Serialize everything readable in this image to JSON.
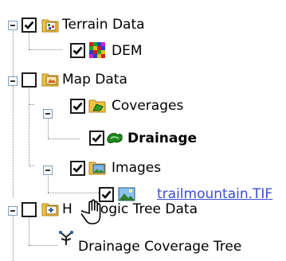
{
  "tree": {
    "terrain_data": {
      "label": "Terrain Data",
      "checked": true
    },
    "dem": {
      "label": "DEM",
      "checked": true
    },
    "map_data": {
      "label": "Map Data",
      "checked": false
    },
    "coverages": {
      "label": "Coverages",
      "checked": true
    },
    "drainage": {
      "label": "Drainage",
      "checked": true
    },
    "images": {
      "label": "Images",
      "checked": true
    },
    "trailmountain": {
      "label": "trailmountain.TIF",
      "checked": true
    },
    "hydrologic_tree_data": {
      "label": "Hydrologic Tree Data",
      "checked": false,
      "visible_text_start": "H",
      "visible_text_end": "ologic Tree Data"
    },
    "drainage_coverage_tree": {
      "label": "Drainage Coverage Tree"
    }
  },
  "colors": {
    "link": "#3a4fd0",
    "folder_yellow": "#f2c240",
    "drainage_green": "#1e8a1e",
    "tree_line": "#8a8a8a"
  },
  "icons": {
    "terrain_data": "terrain-folder-icon",
    "dem": "grid-raster-icon",
    "map_data": "map-folder-icon",
    "coverages": "coverage-folder-icon",
    "drainage": "drainage-polygon-icon",
    "images": "image-folder-icon",
    "trailmountain": "image-thumbnail-icon",
    "hydrologic_tree_data": "tree-folder-icon",
    "drainage_coverage_tree": "tree-node-icon",
    "cursor": "hand-pointer-icon"
  }
}
